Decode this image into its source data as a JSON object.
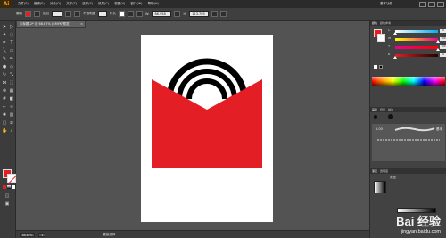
{
  "app": {
    "logo": "Ai",
    "menu": [
      "文件(F)",
      "编辑(E)",
      "对象(O)",
      "文字(T)",
      "选择(S)",
      "效果(C)",
      "视图(V)",
      "窗口(W)",
      "帮助(H)"
    ],
    "workspace": "基本功能"
  },
  "controlbar": {
    "selection_label": "编组",
    "stroke_label": "描边",
    "opacity_label": "不透明度",
    "style_label": "样式",
    "w_label": "W:",
    "w_value": "86.958",
    "h_label": "H:",
    "h_value": "113.705"
  },
  "document": {
    "tab_title": "未标题-2* @ 66.67% (CMYK/预览)",
    "close": "×"
  },
  "statusbar": {
    "zoom": "66.67%",
    "page": "1",
    "tool_status": "直接选择"
  },
  "panels": {
    "color_tabs": [
      "颜色",
      "颜色参考"
    ],
    "sliders": [
      {
        "label": "C",
        "value": "0",
        "color": "#00aeef"
      },
      {
        "label": "M",
        "value": "100",
        "color": "#ec008c"
      },
      {
        "label": "Y",
        "value": "100",
        "color": "#fff200"
      },
      {
        "label": "K",
        "value": "0",
        "color": "#231f20"
      }
    ],
    "brush_tabs": [
      "画笔",
      "符号",
      "描边"
    ],
    "brush_size": "5.00",
    "brush_name": "基本",
    "gradient_tabs": [
      "渐变",
      "透明度"
    ],
    "gradient_type_label": "类型"
  },
  "artwork": {
    "red_color": "#e31e24",
    "arc_color": "#000000"
  },
  "watermark": {
    "brand": "Bai 经验",
    "url": "jingyan.baidu.com"
  }
}
